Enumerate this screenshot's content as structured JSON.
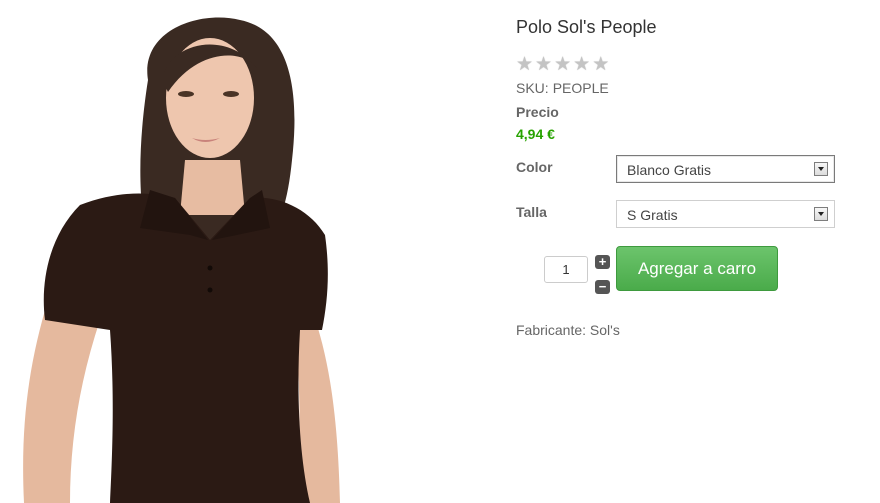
{
  "product": {
    "title": "Polo Sol's People",
    "rating": {
      "value": 0,
      "max": 5
    },
    "sku_label": "SKU:",
    "sku_value": "PEOPLE",
    "price_label": "Precio",
    "price_value": "4,94 €",
    "image": {
      "alt": "Model wearing brown polo shirt"
    }
  },
  "options": {
    "color_label": "Color",
    "color_value": "Blanco Gratis",
    "size_label": "Talla",
    "size_value": "S Gratis"
  },
  "cart": {
    "quantity": "1",
    "plus_symbol": "+",
    "minus_symbol": "−",
    "add_label": "Agregar a carro"
  },
  "manufacturer": {
    "text": "Fabricante: Sol's"
  },
  "colors": {
    "price": "#27a300",
    "cart_button": "#5cb85c",
    "shirt": "#2b1a14"
  }
}
